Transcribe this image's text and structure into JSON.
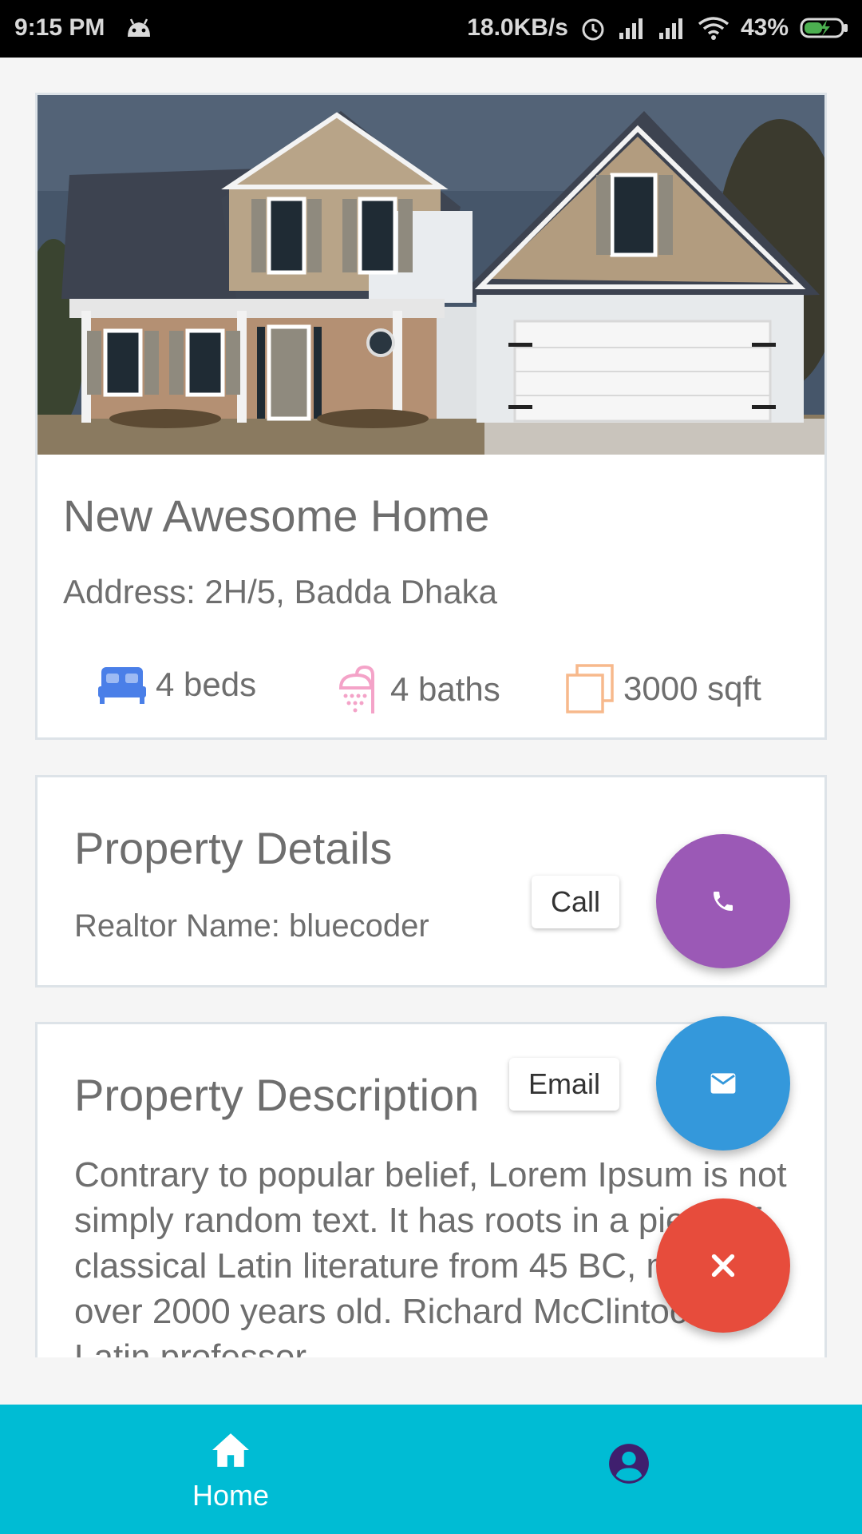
{
  "status_bar": {
    "time": "9:15 PM",
    "net_speed": "18.0KB/s",
    "battery": "43%"
  },
  "property": {
    "title": "New Awesome Home",
    "address": "Address: 2H/5, Badda Dhaka",
    "beds": "4 beds",
    "baths": "4 baths",
    "area": "3000 sqft"
  },
  "details": {
    "heading": "Property Details",
    "realtor": "Realtor Name: bluecoder"
  },
  "description": {
    "heading": "Property Description",
    "text": "Contrary to popular belief, Lorem Ipsum is not simply random text. It has roots in a piece of classical Latin literature from 45 BC, making it over 2000 years old. Richard McClintock, a Latin professor"
  },
  "fab": {
    "call_label": "Call",
    "email_label": "Email"
  },
  "bottom_nav": {
    "home_label": "Home"
  },
  "colors": {
    "call": "#9b59b6",
    "email": "#3498db",
    "close": "#e74c3c",
    "nav": "#00bcd4",
    "bed_icon": "#4a7fe8",
    "bath_icon": "#f4a3c8",
    "sqft_icon": "#f7b98c"
  },
  "icons": {
    "bed": "bed-icon",
    "bath": "shower-icon",
    "sqft": "area-icon",
    "call": "phone-icon",
    "email": "mail-icon",
    "close": "close-icon",
    "home": "home-icon",
    "profile": "account-icon"
  }
}
